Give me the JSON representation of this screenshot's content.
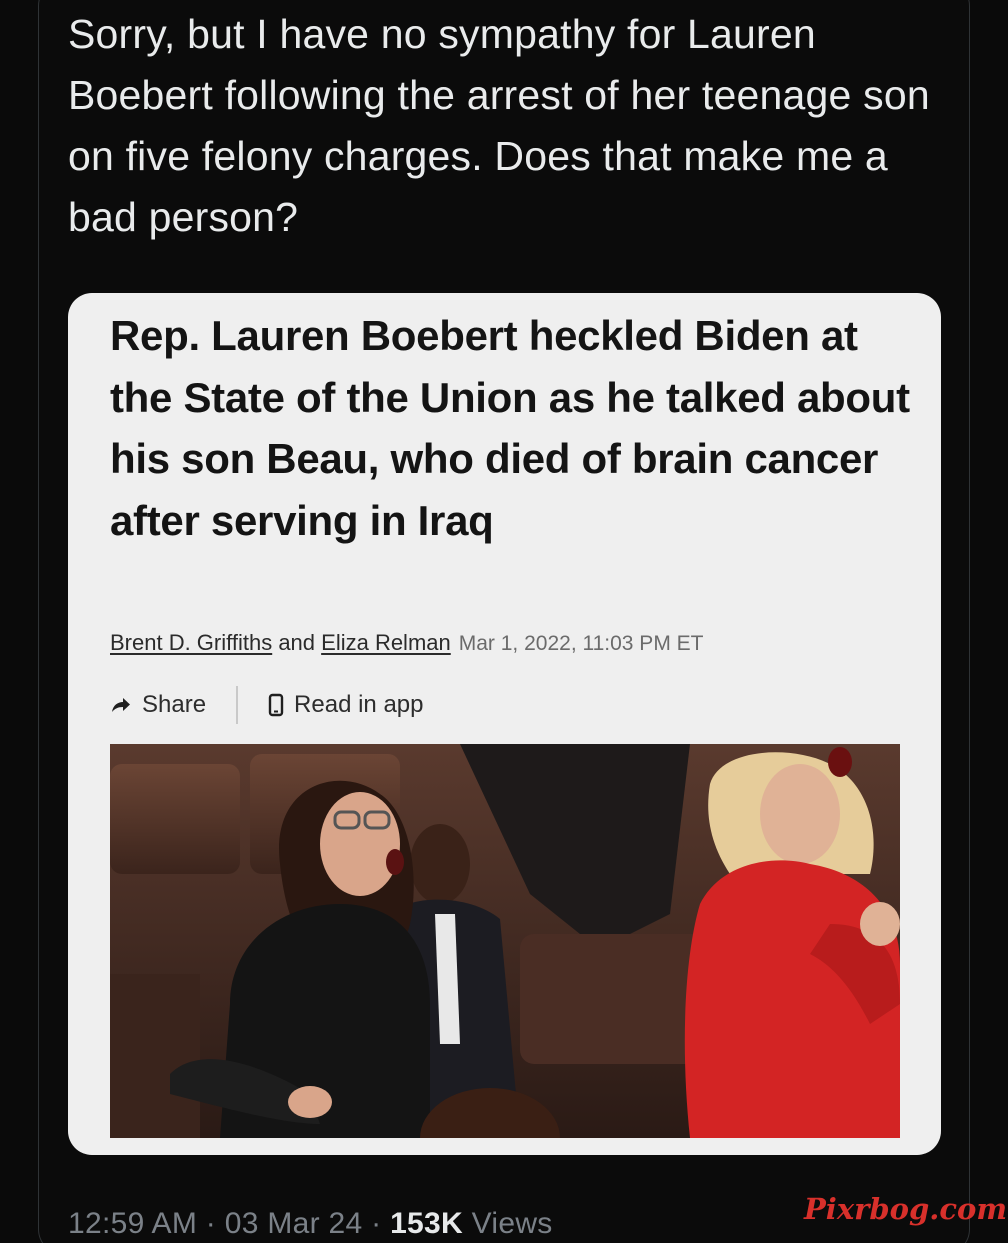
{
  "tweet": {
    "text": "Sorry, but I have no sympathy for Lauren Boebert following the arrest of her teenage son on five felony charges. Does that make me a bad person?",
    "meta": {
      "time": "12:59 AM",
      "separator1": " · ",
      "date": "03 Mar 24",
      "separator2": " · ",
      "views_count": "153K",
      "views_label": " Views"
    }
  },
  "article_card": {
    "headline": "Rep. Lauren Boebert heckled Biden at the State of the Union as he talked about his son Beau, who died of brain cancer after serving in Iraq",
    "author1": "Brent D. Griffiths",
    "conjunction": " and ",
    "author2": "Eliza Relman",
    "date": "Mar 1, 2022, 11:03 PM ET",
    "share_label": "Share",
    "read_in_app_label": "Read in app",
    "share_icon": "share-arrow-icon",
    "read_in_app_icon": "phone-icon"
  },
  "watermark": "Pixrbog.com",
  "colors": {
    "background": "#0a0a0a",
    "card_background": "#efefef",
    "watermark": "#d8302b",
    "muted_text": "#7b8188"
  }
}
